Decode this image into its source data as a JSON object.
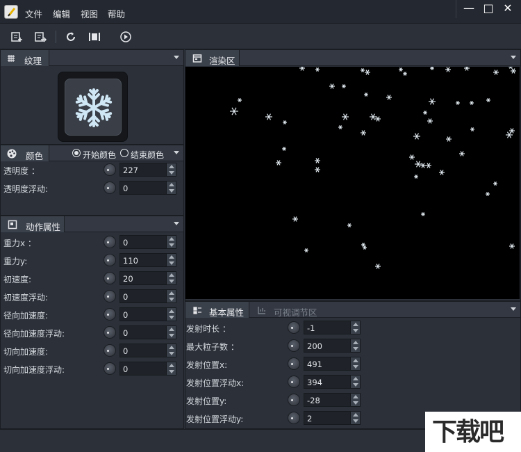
{
  "menu": [
    "文件",
    "编辑",
    "视图",
    "帮助"
  ],
  "window_controls": {
    "minimize": "—",
    "maximize": "□",
    "close": "✕"
  },
  "texture_panel": {
    "title": "纹理",
    "icon": "texture-grid-icon"
  },
  "color_panel": {
    "title": "颜色",
    "start_color": "开始颜色",
    "end_color": "结束颜色",
    "rows": [
      {
        "label": "透明度 ：",
        "value": "227"
      },
      {
        "label": "透明度浮动:",
        "value": "0"
      }
    ]
  },
  "motion_panel": {
    "title": "动作属性",
    "rows": [
      {
        "label": "重力x ：",
        "value": "0"
      },
      {
        "label": "重力y:",
        "value": "110"
      },
      {
        "label": "初速度:",
        "value": "20"
      },
      {
        "label": "初速度浮动:",
        "value": "0"
      },
      {
        "label": "径向加速度:",
        "value": "0"
      },
      {
        "label": "径向加速度浮动:",
        "value": "0"
      },
      {
        "label": "切向加速度:",
        "value": "0"
      },
      {
        "label": "切向加速度浮动:",
        "value": "0"
      }
    ]
  },
  "render_panel": {
    "title": "渲染区"
  },
  "basic_panel": {
    "tab_basic": "基本属性",
    "tab_visual": "可视调节区",
    "rows": [
      {
        "label": "发射时长 ：",
        "value": "-1"
      },
      {
        "label": "最大粒子数 ：",
        "value": "200"
      },
      {
        "label": "发射位置x:",
        "value": "491"
      },
      {
        "label": "发射位置浮动x:",
        "value": "394"
      },
      {
        "label": "发射位置y:",
        "value": "-28"
      },
      {
        "label": "发射位置浮动y:",
        "value": "2"
      }
    ]
  },
  "watermark": {
    "text": "下载吧"
  },
  "colors": {
    "accent": "#e9b400",
    "panel_bg": "#2b3039",
    "header_bg": "#333842"
  }
}
